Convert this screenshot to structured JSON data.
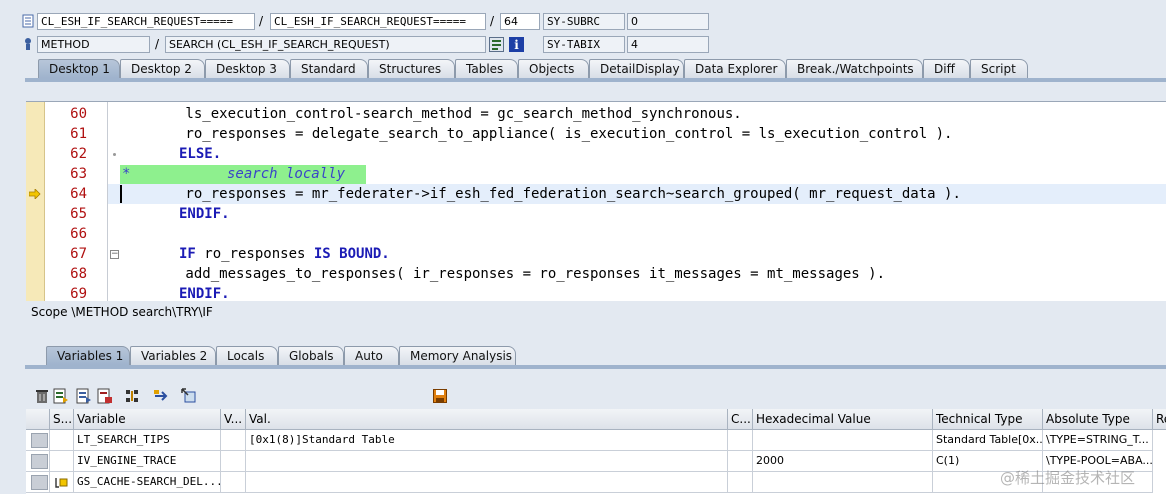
{
  "header": {
    "row1": {
      "program": "CL_ESH_IF_SEARCH_REQUEST=====",
      "include": "CL_ESH_IF_SEARCH_REQUEST=====",
      "line": "64",
      "sysvar_name": "SY-SUBRC",
      "sysvar_value": "0"
    },
    "row2": {
      "type": "METHOD",
      "event": "SEARCH (CL_ESH_IF_SEARCH_REQUEST)",
      "sysvar_name": "SY-TABIX",
      "sysvar_value": "4"
    }
  },
  "tabs": [
    "Desktop 1",
    "Desktop 2",
    "Desktop 3",
    "Standard",
    "Structures",
    "Tables",
    "Objects",
    "DetailDisplay",
    "Data Explorer",
    "Break./Watchpoints",
    "Diff",
    "Script"
  ],
  "code": {
    "line_numbers": [
      "60",
      "61",
      "62",
      "63",
      "64",
      "65",
      "66",
      "67",
      "68",
      "69"
    ],
    "lines": {
      "l60": "        ls_execution_control-search_method = gc_search_method_synchronous.",
      "l61": "        ro_responses = delegate_search_to_appliance( is_execution_control = ls_execution_control ).",
      "l62": "ELSE.",
      "l63_star": "*",
      "l63_comment": "search locally",
      "l64": "        ro_responses = mr_federater->if_esh_fed_federation_search~search_grouped( mr_request_data ).",
      "l65": "ENDIF.",
      "l66": "",
      "l67_kw1": "IF",
      "l67_mid": " ro_responses ",
      "l67_kw2": "IS BOUND.",
      "l68": "        add_messages_to_responses( ir_responses = ro_responses it_messages = mt_messages ).",
      "l69": "ENDIF."
    }
  },
  "scope": "Scope \\METHOD search\\TRY\\IF",
  "var_tabs": [
    "Variables 1",
    "Variables 2",
    "Locals",
    "Globals",
    "Auto",
    "Memory Analysis"
  ],
  "table": {
    "headers": [
      "S...",
      "Variable",
      "V...",
      "Val.",
      "C...",
      "Hexadecimal Value",
      "Technical Type",
      "Absolute Type",
      "Re"
    ],
    "rows": [
      {
        "variable": "LT_SEARCH_TIPS",
        "val": "[0x1(8)]Standard Table",
        "hex": "",
        "tech": "Standard Table[0x...",
        "abs": "\\TYPE=STRING_T..."
      },
      {
        "variable": "IV_ENGINE_TRACE",
        "val": "",
        "hex": "2000",
        "tech": "C(1)",
        "abs": "\\TYPE-POOL=ABA..."
      },
      {
        "variable": "GS_CACHE-SEARCH_DEL...",
        "val": "",
        "hex": "",
        "tech": "",
        "abs": ""
      }
    ]
  },
  "watermark": "@稀土掘金技术社区",
  "colors": {
    "accent": "#9fb3cd",
    "current_line": "#e4eefb",
    "comment_highlight": "#8ef08e",
    "gutter": "#f6e9b8"
  }
}
